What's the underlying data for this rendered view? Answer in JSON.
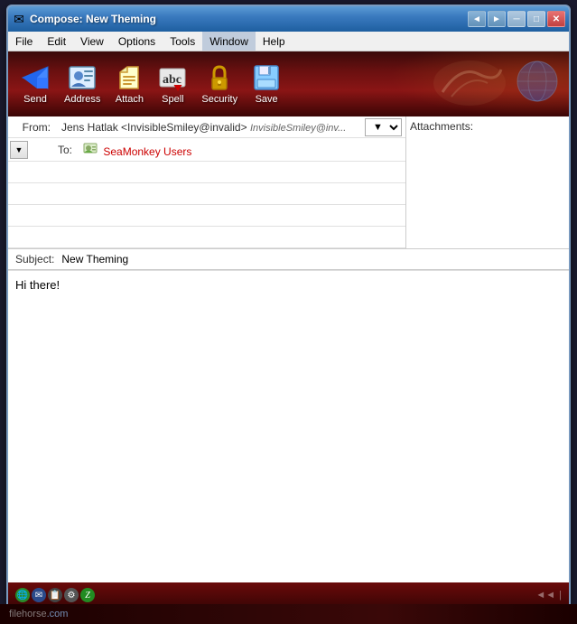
{
  "window": {
    "title": "Compose: New Theming",
    "icon": "✉"
  },
  "titlebar": {
    "buttons": {
      "scroll_left": "◄",
      "scroll_right": "►",
      "minimize": "─",
      "maximize": "□",
      "close": "✕"
    }
  },
  "menubar": {
    "items": [
      {
        "id": "file",
        "label": "File"
      },
      {
        "id": "edit",
        "label": "Edit"
      },
      {
        "id": "view",
        "label": "View"
      },
      {
        "id": "options",
        "label": "Options"
      },
      {
        "id": "tools",
        "label": "Tools"
      },
      {
        "id": "window",
        "label": "Window"
      },
      {
        "id": "help",
        "label": "Help"
      }
    ]
  },
  "toolbar": {
    "buttons": [
      {
        "id": "send",
        "label": "Send",
        "icon": "✈"
      },
      {
        "id": "address",
        "label": "Address",
        "icon": "👤"
      },
      {
        "id": "attach",
        "label": "Attach",
        "icon": "📎"
      },
      {
        "id": "spell",
        "label": "Spell",
        "icon": "abc"
      },
      {
        "id": "security",
        "label": "Security",
        "icon": "🔒"
      },
      {
        "id": "save",
        "label": "Save",
        "icon": "💾"
      }
    ]
  },
  "email": {
    "from_label": "From:",
    "from_name": "Jens Hatlak <InvisibleSmiley@invalid>",
    "from_italic": "InvisibleSmiley@inv...",
    "to_label": "To:",
    "to_recipient": "SeaMonkey Users",
    "subject_label": "Subject:",
    "subject_value": "New Theming",
    "body_text": "Hi there!",
    "attachments_label": "Attachments:"
  },
  "statusbar": {
    "icons": [
      "🌐",
      "✉",
      "📋",
      "⚙",
      "Z"
    ]
  },
  "footer": {
    "text": "filehorse",
    "com": ".com"
  }
}
